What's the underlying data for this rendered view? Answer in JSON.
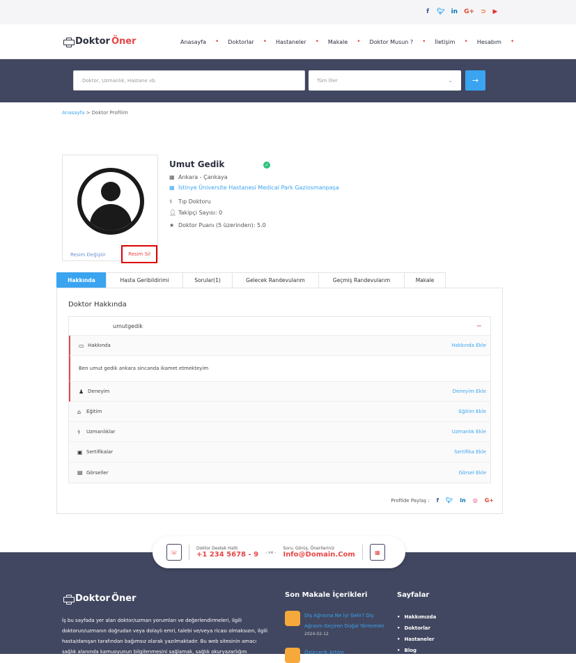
{
  "social": [
    "f",
    "t",
    "in",
    "G+",
    "rss",
    "yt"
  ],
  "social_colors": {
    "f": "#3b5998",
    "t": "#1da1f2",
    "in": "#0077b5",
    "G+": "#dd4b39",
    "rss": "#f26522",
    "yt": "#e52d27"
  },
  "brand": {
    "part1": "Doktor",
    "part2": "Öner"
  },
  "menu": [
    "Anasayfa",
    "Doktorlar",
    "Hastaneler",
    "Makale",
    "Doktor Musun ?",
    "İletişim",
    "Hesabım"
  ],
  "search": {
    "placeholder": "Doktor, Uzmanlık, Hastane vb.",
    "city": "Tüm İller",
    "button_icon": "arrow-right-icon"
  },
  "breadcrumb": {
    "home": "Anasayfa",
    "current": "Doktor Profilim"
  },
  "profile": {
    "change_photo": "Resim Değiştir",
    "delete_photo": "Resim Sil",
    "name": "Umut Gedik",
    "location": "Ankara - Çankaya",
    "hospital": "İstinye Üniversite Hastanesi Medical Park Gaziosmanpaşa",
    "title": "Tıp Doktoru",
    "followers": "Takipçi Sayısı: 0",
    "rating": "Doktor Puanı (5 üzerinden): 5.0"
  },
  "tabs": [
    "Hakkında",
    "Hasta Geribildirimi",
    "Sorular(1)",
    "Gelecek Randevularım",
    "Geçmiş Randevularım",
    "Makale"
  ],
  "about": {
    "heading": "Doktor Hakkında",
    "username": "umutgedik",
    "sections": [
      {
        "label": "Hakkında",
        "action": "Hakkında Ekle"
      },
      {
        "label": "Deneyim",
        "action": "Deneyim Ekle"
      },
      {
        "label": "Eğitim",
        "action": "Eğitim Ekle"
      },
      {
        "label": "Uzmanlıklar",
        "action": "Uzmanlık Ekle"
      },
      {
        "label": "Sertifikalar",
        "action": "Sertifika Ekle"
      },
      {
        "label": "Görseller",
        "action": "Görsel Ekle"
      }
    ],
    "description": "Ben umut gedik ankara sincanda ikamet etmekteyim",
    "share_label": "Profilde Paylaş :"
  },
  "support": {
    "line_label": "Doktor Destek Hattı",
    "phone": "+1 234 5678 - 9",
    "and": "- ve -",
    "mail_label": "Soru, Görüş, Önerileriniz",
    "email": "Info@Domain.Com"
  },
  "footer": {
    "description": "İş bu sayfada yer alan doktor/uzman yorumları ve değerlendirmeleri, ilgili doktorun/uzmanın doğrudan veya dolaylı emri, talebi ve/veya ricası olmaksızın, ilgili hasta/danışan tarafından bağımsız olarak yazılmaktadır. Bu web sitesinin amacı sağlık alanında kamuoyunun bilgilenmesini sağlamak, sağlık okuryazarlığını",
    "articles_heading": "Son Makale İçerikleri",
    "articles": [
      {
        "title": "Diş Ağrısına Ne İyi Gelir? Diş Ağrısını Geçiren Doğal Yöntemler",
        "date": "2024-02-12"
      },
      {
        "title": "Özürcerik Artılm",
        "date": ""
      }
    ],
    "pages_heading": "Sayfalar",
    "pages": [
      "Hakkımızda",
      "Doktorlar",
      "Hastaneler",
      "Blog"
    ]
  }
}
